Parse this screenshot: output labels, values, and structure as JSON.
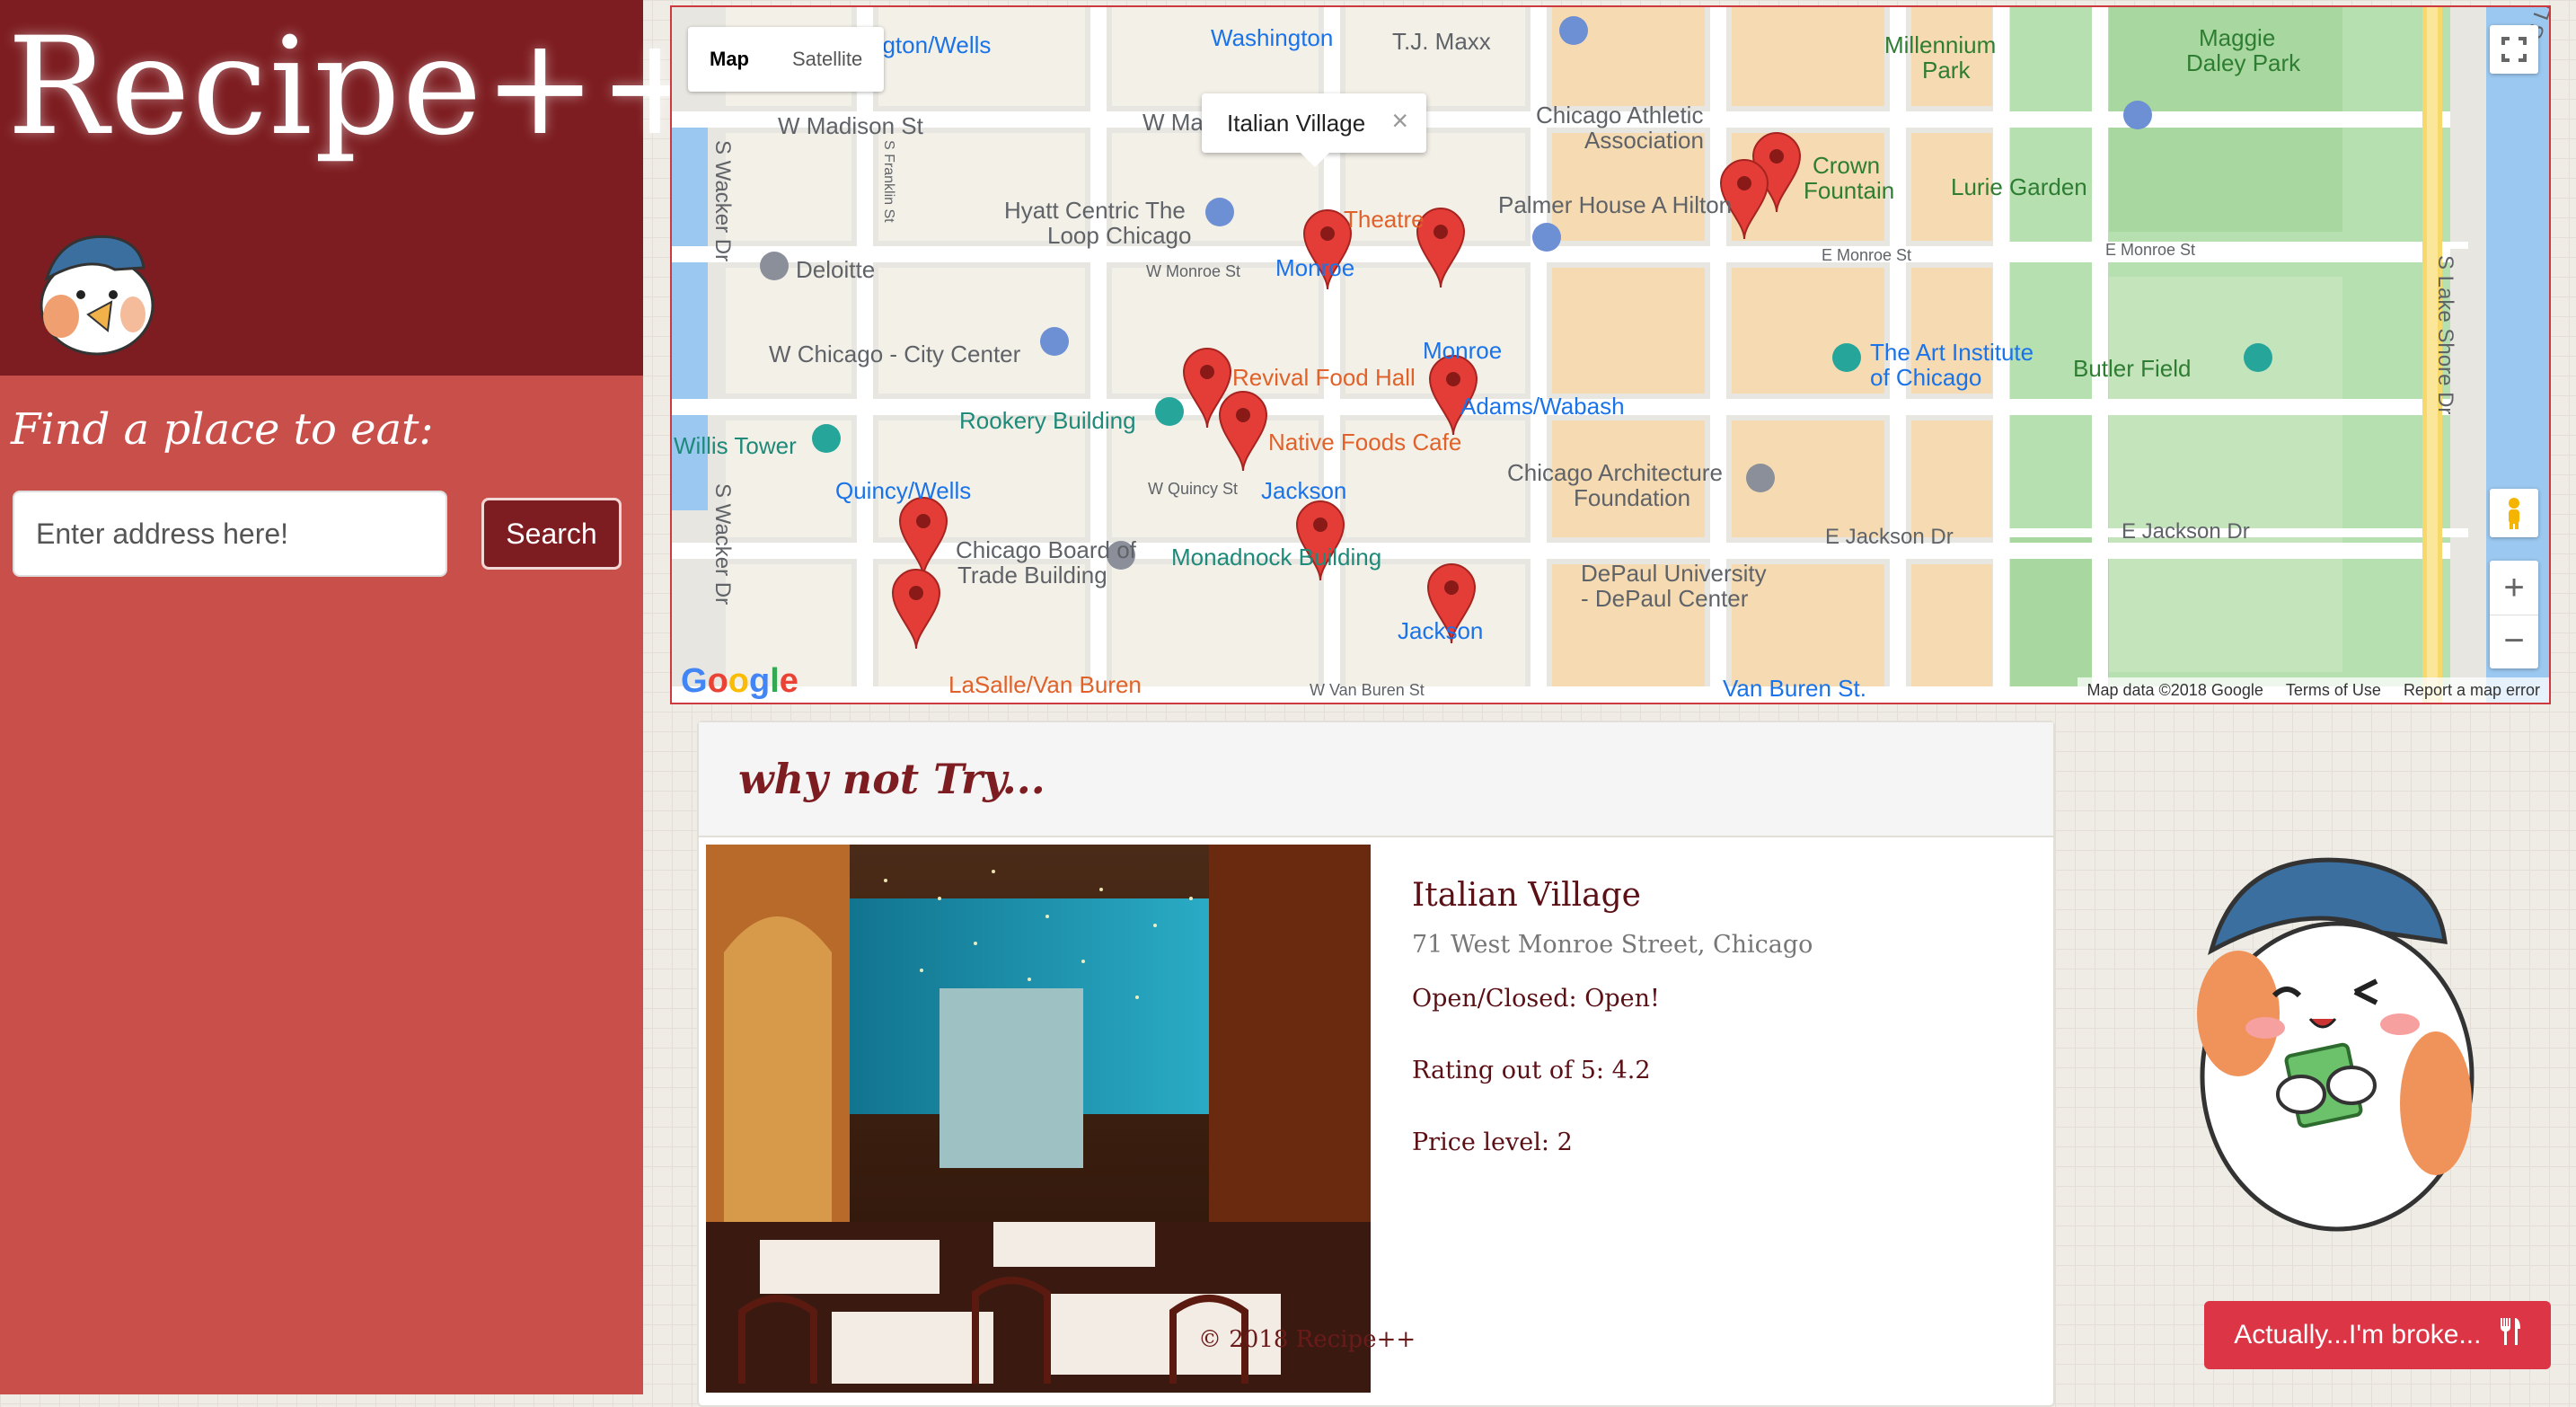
{
  "app": {
    "logo_text": "Recipe++"
  },
  "sidebar": {
    "find_label": "Find a place to eat:",
    "address_placeholder": "Enter address here!",
    "address_value": "",
    "search_label": "Search"
  },
  "map": {
    "type_buttons": [
      "Map",
      "Satellite"
    ],
    "selected_type": "Map",
    "info_window_title": "Italian Village",
    "fullscreen_icon": "fullscreen-icon",
    "pegman_icon": "pegman-icon",
    "zoom_in": "+",
    "zoom_out": "−",
    "google_logo": "Google",
    "attribution": {
      "data": "Map data ©2018 Google",
      "terms": "Terms of Use",
      "report": "Report a map error"
    },
    "labels": {
      "washington": "Washington",
      "tjmaxx": "T.J. Maxx",
      "wells": "ngton/Wells",
      "wmadison": "W Madison St",
      "wma": "W Ma",
      "chicago_athletic_1": "Chicago Athletic",
      "chicago_athletic_2": "Association",
      "millennium_1": "Millennium",
      "millennium_2": "Park",
      "maggie_1": "Maggie",
      "maggie_2": "Daley Park",
      "crown_1": "Crown",
      "crown_2": "Fountain",
      "lurie": "Lurie Garden",
      "hyatt_1": "Hyatt Centric The",
      "hyatt_2": "Loop Chicago",
      "theatre": "Theatre",
      "palmer": "Palmer House A Hilton",
      "deloitte": "Deloitte",
      "wmonroe": "W Monroe St",
      "monroe_m": "Monroe",
      "emonroe1": "E Monroe St",
      "emonroe2": "E Monroe St",
      "wchicago": "W Chicago - City Center",
      "revival": "Revival Food Hall",
      "monroe2": "Monroe",
      "art_1": "The Art Institute",
      "art_2": "of Chicago",
      "butler": "Butler Field",
      "rookery": "Rookery Building",
      "adams": "Adams/Wabash",
      "willis": "Willis Tower",
      "native": "Native Foods Cafe",
      "quincy": "Quincy/Wells",
      "wquincy": "W Quincy St",
      "jackson1": "Jackson",
      "arch_1": "Chicago Architecture",
      "arch_2": "Foundation",
      "cbot_1": "Chicago Board of",
      "cbot_2": "Trade Building",
      "monadnock": "Monadnock Building",
      "ejackson1": "E Jackson Dr",
      "ejackson2": "E Jackson Dr",
      "depaul_1": "DePaul University",
      "depaul_2": "- DePaul Center",
      "jackson2": "Jackson",
      "lasalle": "LaSalle/Van Buren",
      "wvanburen": "W Van Buren St",
      "vanburen": "Van Buren St.",
      "swacker1": "S Wacker Dr",
      "swacker2": "S Wacker Dr",
      "sfranklin": "S Franklin St",
      "slakeshore1": "S Lake Shore Dr",
      "slakeshore2": "S Lake Shore Dr"
    }
  },
  "suggestion": {
    "heading": "why not Try...",
    "name": "Italian Village",
    "address": "71 West Monroe Street, Chicago",
    "open_label": "Open/Closed: ",
    "open_value": "Open!",
    "rating_label": "Rating out of 5: ",
    "rating_value": "4.2",
    "price_label": "Price level: ",
    "price_value": "2",
    "photo_icon": "restaurant-photo",
    "copyright": "© 2018 Recipe++"
  },
  "broke_button": {
    "label": "Actually...I'm broke...",
    "icon": "utensils-icon"
  },
  "colors": {
    "brand_dark": "#7d1d21",
    "sidebar": "#c9504a",
    "accent_button": "#dc3545"
  }
}
